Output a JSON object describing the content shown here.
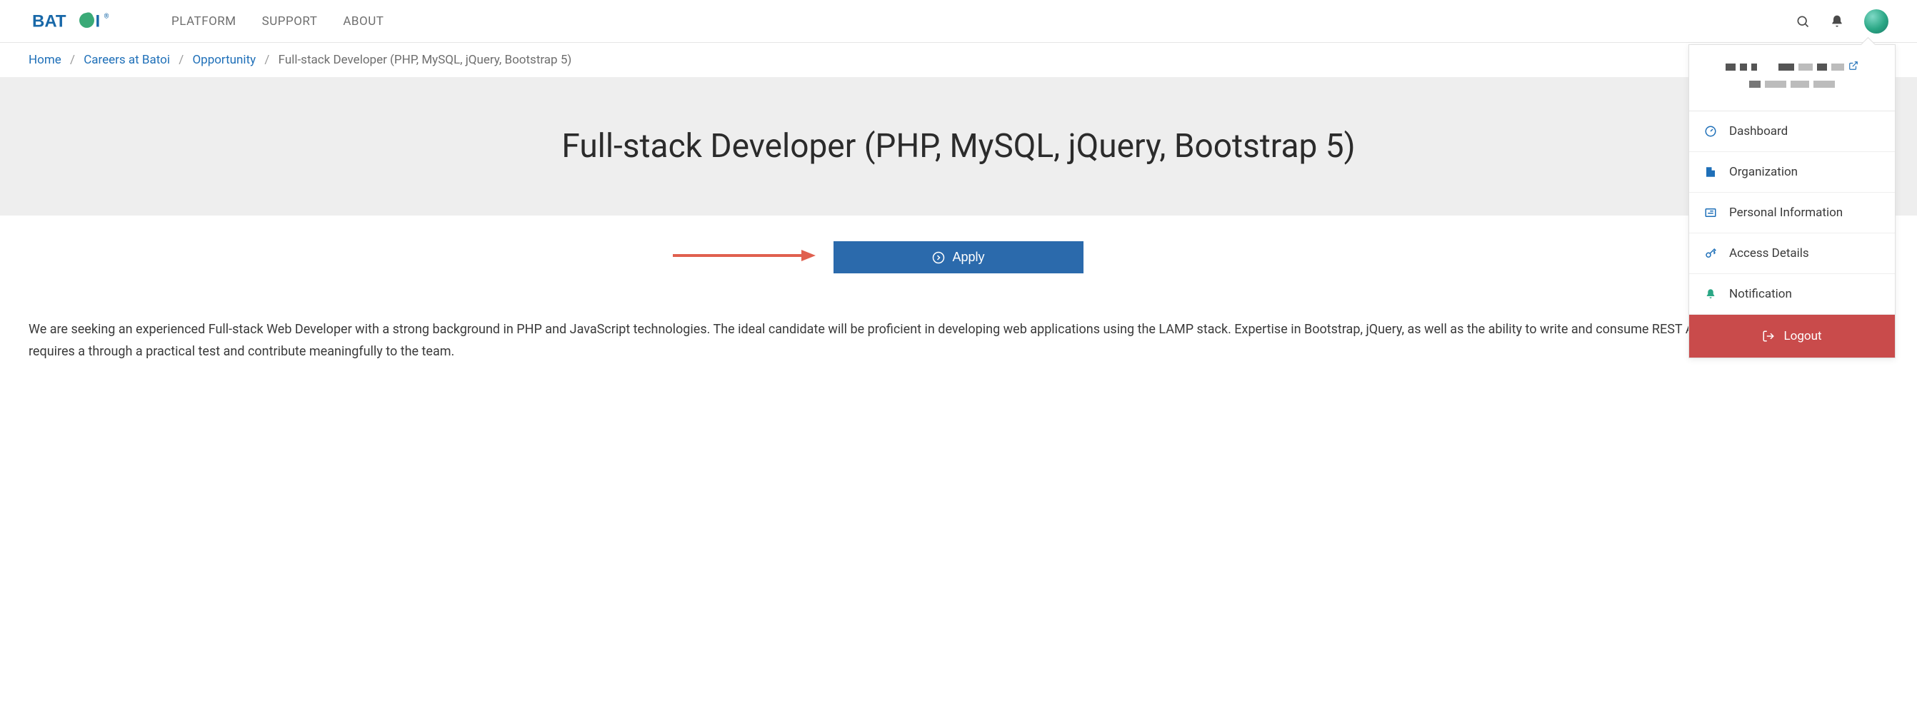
{
  "nav": {
    "items": [
      "PLATFORM",
      "SUPPORT",
      "ABOUT"
    ]
  },
  "breadcrumb": {
    "home": "Home",
    "careers": "Careers at Batoi",
    "opportunity": "Opportunity",
    "current": "Full-stack Developer (PHP, MySQL, jQuery, Bootstrap 5)"
  },
  "hero": {
    "title": "Full-stack Developer (PHP, MySQL, jQuery, Bootstrap 5)"
  },
  "apply": {
    "label": "Apply"
  },
  "body": {
    "paragraph": "We are seeking an experienced Full-stack Web Developer with a strong background in PHP and JavaScript technologies. The ideal candidate will be proficient in developing web applications using the LAMP stack. Expertise in Bootstrap, jQuery, as well as the ability to write and consume REST APIs, is highly desirable. This role requires a through a practical test and contribute meaningfully to the team."
  },
  "dropdown": {
    "dashboard": "Dashboard",
    "organization": "Organization",
    "personal": "Personal Information",
    "access": "Access Details",
    "notification": "Notification",
    "logout": "Logout"
  }
}
